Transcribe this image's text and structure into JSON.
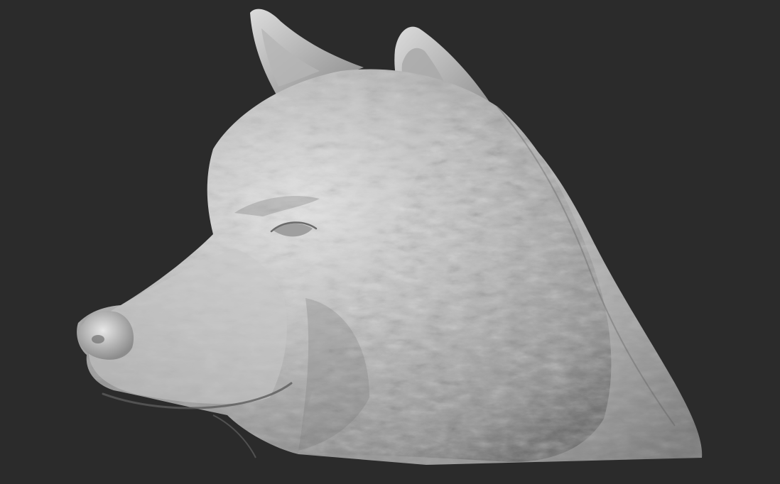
{
  "viewport": {
    "background": "#2b2b2b",
    "subject": "wolf-head-sculpt",
    "material_base": "#9a9a9a",
    "material_highlight": "#e6e6e6",
    "material_shadow": "#4a4a4a"
  }
}
